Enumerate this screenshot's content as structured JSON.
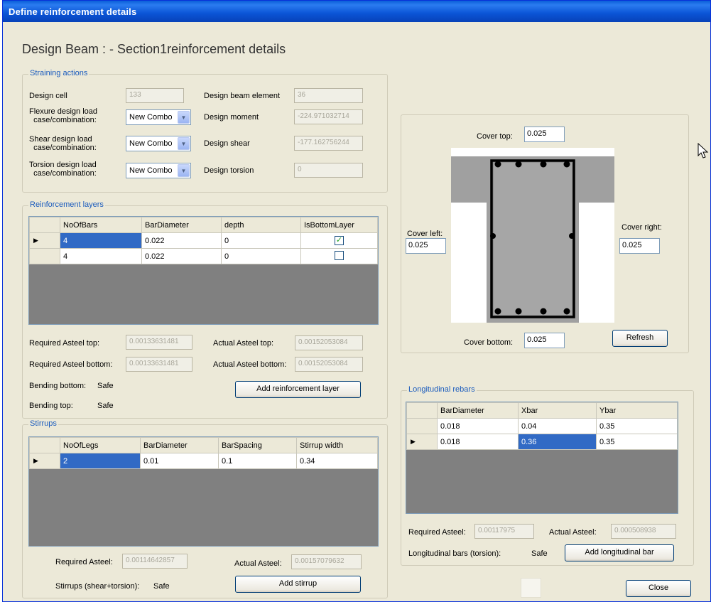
{
  "window": {
    "title": "Define reinforcement details"
  },
  "heading": "Design Beam : - Section1reinforcement details",
  "straining": {
    "title": "Straining actions",
    "design_cell_label": "Design cell",
    "design_cell_value": "133",
    "beam_element_label": "Design beam element",
    "beam_element_value": "36",
    "flexure_label_1": "Flexure design load",
    "flexure_label_2": "case/combination:",
    "flexure_combo": "New Combo",
    "moment_label": "Design moment",
    "moment_value": "-224.971032714",
    "shear_label_1": "Shear design load",
    "shear_label_2": "case/combination:",
    "shear_combo": "New Combo",
    "shear_value_label": "Design shear",
    "shear_value": "-177.162756244",
    "torsion_label_1": "Torsion design load",
    "torsion_label_2": "case/combination:",
    "torsion_combo": "New Combo",
    "torsion_value_label": "Design torsion",
    "torsion_value": "0"
  },
  "layers": {
    "title": "Reinforcement layers",
    "headers": [
      "NoOfBars",
      "BarDiameter",
      "depth",
      "IsBottomLayer"
    ],
    "rows": [
      {
        "bars": "4",
        "dia": "0.022",
        "depth": "0",
        "bottom": true
      },
      {
        "bars": "4",
        "dia": "0.022",
        "depth": "0",
        "bottom": false
      }
    ],
    "req_top_label": "Required Asteel top:",
    "req_top_value": "0.00133631481",
    "act_top_label": "Actual Asteel top:",
    "act_top_value": "0.00152053084",
    "req_bot_label": "Required Asteel bottom:",
    "req_bot_value": "0.00133631481",
    "act_bot_label": "Actual Asteel bottom:",
    "act_bot_value": "0.00152053084",
    "bend_bot_label": "Bending bottom:",
    "bend_bot_value": "Safe",
    "bend_top_label": "Bending top:",
    "bend_top_value": "Safe",
    "add_button": "Add reinforcement layer"
  },
  "stirrups": {
    "title": "Stirrups",
    "headers": [
      "NoOfLegs",
      "BarDiameter",
      "BarSpacing",
      "Stirrup width"
    ],
    "rows": [
      {
        "legs": "2",
        "dia": "0.01",
        "spacing": "0.1",
        "width": "0.34"
      }
    ],
    "req_label": "Required Asteel:",
    "req_value": "0.00114642857",
    "act_label": "Actual Asteel:",
    "act_value": "0.00157079632",
    "status_label": "Stirrups (shear+torsion):",
    "status_value": "Safe",
    "add_button": "Add stirrup"
  },
  "section": {
    "cover_top_label": "Cover top:",
    "cover_top": "0.025",
    "cover_left_label": "Cover left:",
    "cover_left": "0.025",
    "cover_right_label": "Cover right:",
    "cover_right": "0.025",
    "cover_bottom_label": "Cover bottom:",
    "cover_bottom": "0.025",
    "refresh_button": "Refresh"
  },
  "longitudinal": {
    "title": "Longitudinal rebars",
    "headers": [
      "BarDiameter",
      "Xbar",
      "Ybar"
    ],
    "rows": [
      {
        "dia": "0.018",
        "x": "0.04",
        "y": "0.35"
      },
      {
        "dia": "0.018",
        "x": "0.36",
        "y": "0.35"
      }
    ],
    "req_label": "Required Asteel:",
    "req_value": "0.00117975",
    "act_label": "Actual Asteel:",
    "act_value": "0.000508938",
    "status_label": "Longitudinal bars (torsion):",
    "status_value": "Safe",
    "add_button": "Add longitudinal bar"
  },
  "close_button": "Close",
  "colors": {
    "title_bar": "#0a54d6",
    "selection": "#316ac5",
    "group_title": "#1a5bbd",
    "dialog": "#ece9d8"
  },
  "icons": {
    "cursor": "mouse-pointer-icon"
  }
}
